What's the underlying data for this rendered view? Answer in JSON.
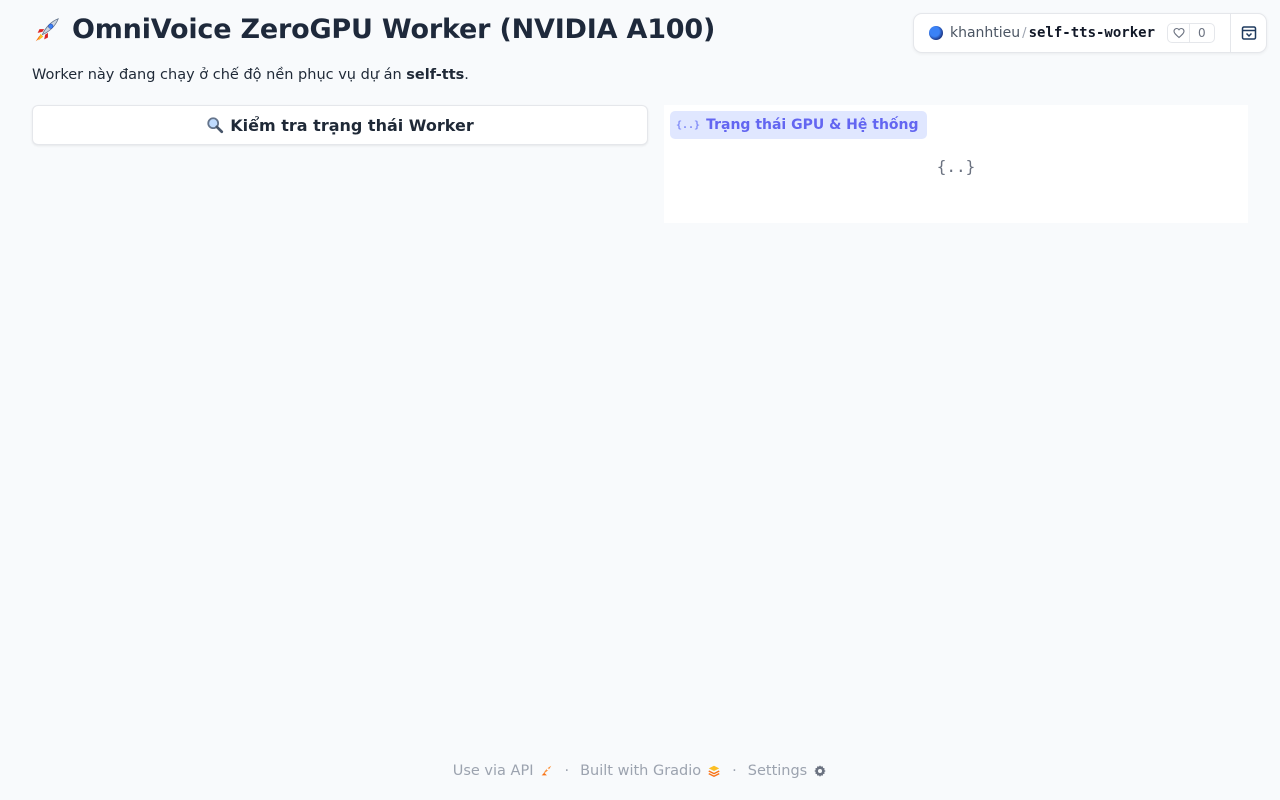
{
  "header": {
    "title": "OmniVoice ZeroGPU Worker (NVIDIA A100)",
    "title_icon": "rocket-icon",
    "subtitle_prefix": "Worker này đang chạy ở chế độ nền phục vụ dự án ",
    "subtitle_project": "self-tts",
    "subtitle_suffix": "."
  },
  "space": {
    "owner": "khanhtieu",
    "separator": "/",
    "repo": "self-tts-worker",
    "like_count": "0",
    "like_icon": "heart-icon",
    "collapse_icon": "collapse-icon"
  },
  "main": {
    "check_button_label": "Kiểm tra trạng thái Worker",
    "check_button_icon": "magnifier-icon",
    "json_label": "Trạng thái GPU & Hệ thống",
    "json_empty": "{..}"
  },
  "footer": {
    "api_label": "Use via API",
    "built_label": "Built with Gradio",
    "settings_label": "Settings",
    "separator": "·"
  },
  "colors": {
    "background": "#f8fafc",
    "json_label_bg": "#e0e7ff",
    "json_label_text": "#6366f1",
    "gradio_orange": "#f97316"
  }
}
